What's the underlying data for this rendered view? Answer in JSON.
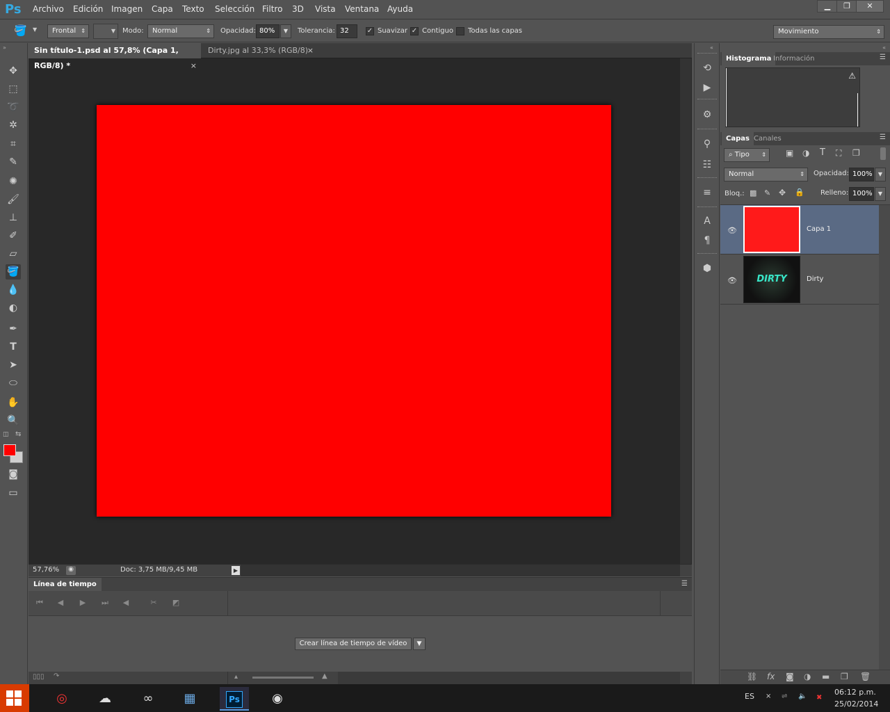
{
  "app": {
    "logo": "Ps",
    "menu": [
      "Archivo",
      "Edición",
      "Imagen",
      "Capa",
      "Texto",
      "Selección",
      "Filtro",
      "3D",
      "Vista",
      "Ventana",
      "Ayuda"
    ],
    "window_controls": {
      "minimize": "▁",
      "restore": "❐",
      "close": "✕"
    }
  },
  "options": {
    "fill_source": "Frontal",
    "mode_label": "Modo:",
    "mode_value": "Normal",
    "opacity_label": "Opacidad:",
    "opacity_value": "80%",
    "tolerance_label": "Tolerancia:",
    "tolerance_value": "32",
    "smooth_label": "Suavizar",
    "contiguous_label": "Contiguo",
    "all_layers_label": "Todas las capas",
    "workspace": "Movimiento"
  },
  "tabs": [
    {
      "title": "Sin título-1.psd al 57,8% (Capa 1, RGB/8) *",
      "close": "×"
    },
    {
      "title": "Dirty.jpg al 33,3% (RGB/8)",
      "close": "×"
    }
  ],
  "status": {
    "zoom": "57,76%",
    "doc": "Doc: 3,75 MB/9,45 MB"
  },
  "timeline": {
    "title": "Línea de tiempo",
    "create_button": "Crear línea de tiempo de vídeo"
  },
  "panels": {
    "histogram_tab": "Histograma",
    "info_tab": "Información",
    "layers_tab": "Capas",
    "channels_tab": "Canales",
    "filter_kind": "Tipo",
    "blend_mode": "Normal",
    "opacity_label": "Opacidad:",
    "opacity_value": "100%",
    "lock_label": "Bloq.:",
    "fill_label": "Relleno:",
    "fill_value": "100%",
    "thumb_text": "DIRTY"
  },
  "layers": [
    {
      "name": "Capa 1",
      "selected": true
    },
    {
      "name": "Dirty",
      "selected": false
    }
  ],
  "taskbar": {
    "language": "ES",
    "time": "06:12 p.m.",
    "date": "25/02/2014"
  },
  "colors": {
    "canvas": "#ff0000",
    "foreground": "#ff0000",
    "background": "#d0d0d0",
    "selected_layer": "#5a6a84"
  }
}
